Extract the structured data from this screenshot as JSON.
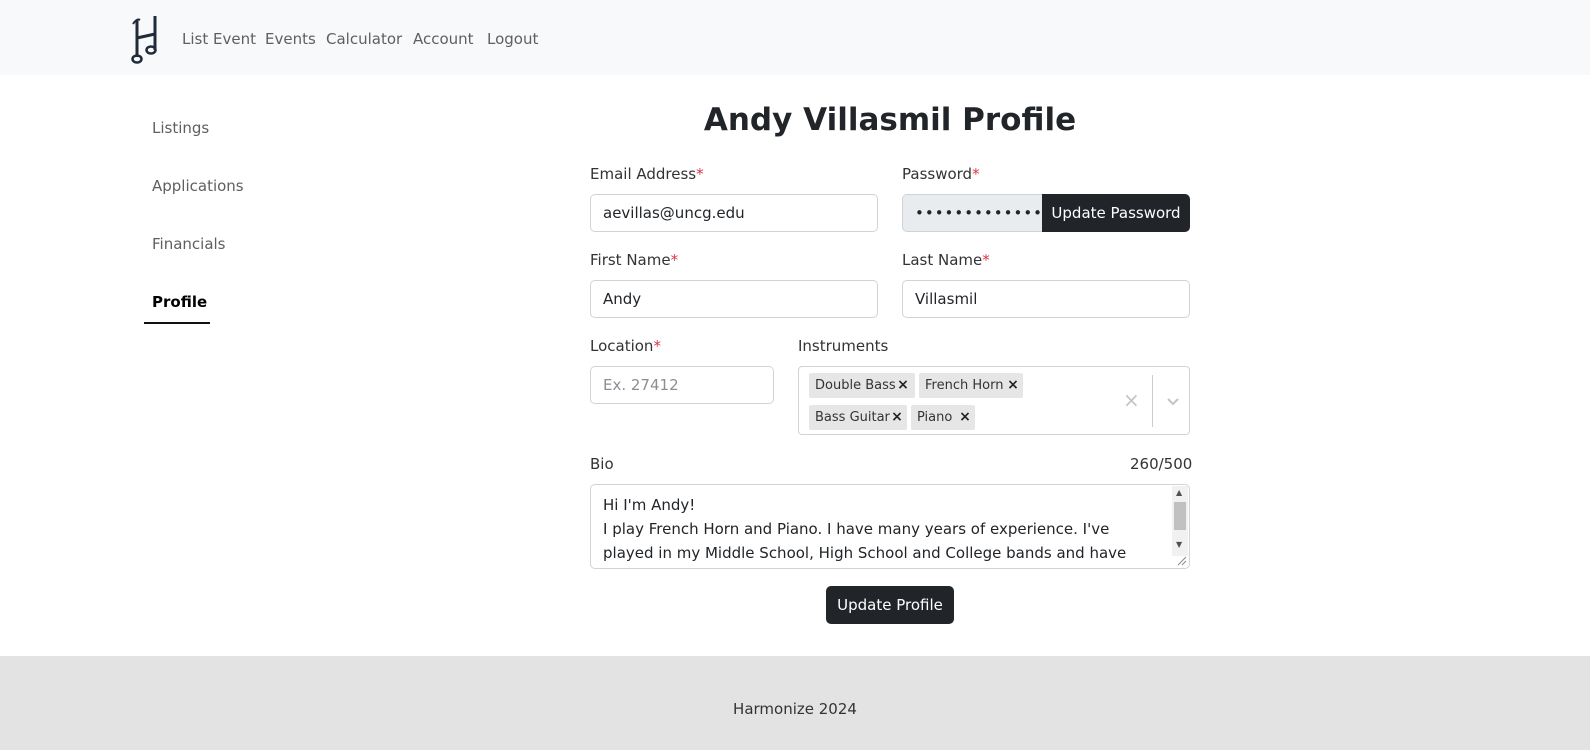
{
  "navbar": {
    "logo_icon": "harmonize-note-logo",
    "links": [
      "List Event",
      "Events",
      "Calculator",
      "Account",
      "Logout"
    ]
  },
  "sidebar": {
    "items": [
      {
        "label": "Listings",
        "active": false
      },
      {
        "label": "Applications",
        "active": false
      },
      {
        "label": "Financials",
        "active": false
      },
      {
        "label": "Profile",
        "active": true
      }
    ]
  },
  "page": {
    "title": "Andy Villasmil Profile"
  },
  "form": {
    "required_mark": "*",
    "email": {
      "label": "Email Address",
      "value": "aevillas@uncg.edu"
    },
    "password": {
      "label": "Password",
      "value": "•••••••••••••",
      "button": "Update Password"
    },
    "first_name": {
      "label": "First Name",
      "value": "Andy"
    },
    "last_name": {
      "label": "Last Name",
      "value": "Villasmil"
    },
    "location": {
      "label": "Location",
      "value": "",
      "placeholder": "Ex. 27412"
    },
    "instruments": {
      "label": "Instruments",
      "selected": [
        "Double Bass",
        "French Horn",
        "Bass Guitar",
        "Piano"
      ],
      "remove_glyph": "×",
      "clear_glyph": "×"
    },
    "bio": {
      "label": "Bio",
      "counter": "260/500",
      "value": "Hi I'm Andy!\nI play French Horn and Piano. I have many years of experience. I've played in my Middle School, High School and College bands and have done a handful of"
    },
    "submit_label": "Update Profile"
  },
  "footer": {
    "text": "Harmonize 2024"
  },
  "colors": {
    "navbar_bg": "#f8f9fa",
    "dark_button": "#212529",
    "required": "#dc3545",
    "footer_bg": "#e3e3e3"
  }
}
